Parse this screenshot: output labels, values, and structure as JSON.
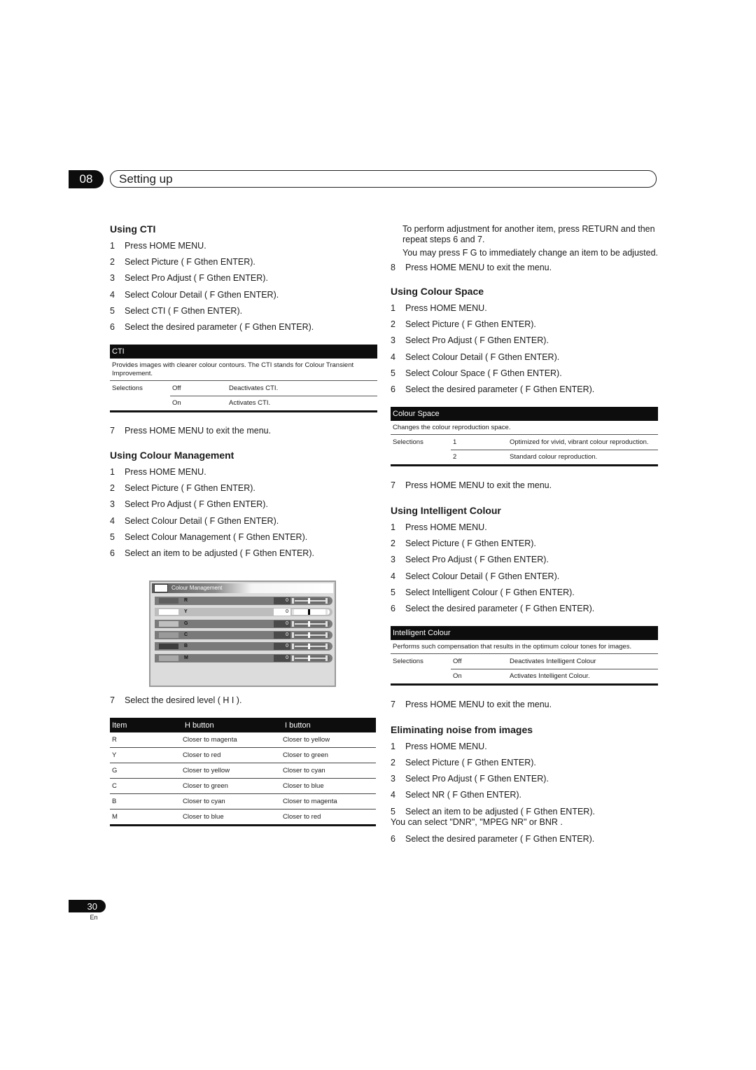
{
  "header": {
    "chapter_number": "08",
    "chapter_title": "Setting up"
  },
  "cti": {
    "title": "Using CTI",
    "steps": [
      {
        "n": "1",
        "text": "Press HOME MENU."
      },
      {
        "n": "2",
        "text": "Select  Picture  (   F   Gthen ENTER)."
      },
      {
        "n": "3",
        "text": "Select  Pro Adjust  (   F   Gthen ENTER)."
      },
      {
        "n": "4",
        "text": "Select  Colour Detail  (    F   Gthen ENTER)."
      },
      {
        "n": "5",
        "text": "Select  CTI  (  F   Gthen ENTER)."
      },
      {
        "n": "6",
        "text": "Select the desired parameter (    F   Gthen ENTER)."
      }
    ],
    "table": {
      "head": "CTI",
      "desc": "Provides images with clearer colour contours. The CTI stands for Colour Transient Improvement.",
      "selections_label": "Selections",
      "rows": [
        {
          "option": "Off",
          "meaning": "Deactivates CTI."
        },
        {
          "option": "On",
          "meaning": "Activates CTI."
        }
      ]
    },
    "step7": {
      "n": "7",
      "text": "Press HOME MENU to exit the menu."
    }
  },
  "colour_management": {
    "title": "Using Colour Management",
    "steps": [
      {
        "n": "1",
        "text": "Press HOME MENU."
      },
      {
        "n": "2",
        "text": "Select  Picture  (   F   Gthen ENTER)."
      },
      {
        "n": "3",
        "text": "Select  Pro Adjust  (   F   Gthen ENTER)."
      },
      {
        "n": "4",
        "text": "Select  Colour Detail  (    F   Gthen ENTER)."
      },
      {
        "n": "5",
        "text": "Select  Colour Management  (     F   Gthen ENTER)."
      },
      {
        "n": "6",
        "text": "Select an item to be adjusted (    F   Gthen ENTER)."
      }
    ],
    "osd": {
      "title": "Colour Management",
      "selected_item": "Y",
      "rows": [
        {
          "label": "R",
          "value": "0",
          "swatch": "#5e5e5e",
          "level": 0.5
        },
        {
          "label": "Y",
          "value": "0",
          "swatch": "#ffffff",
          "level": 0.5
        },
        {
          "label": "G",
          "value": "0",
          "swatch": "#bfbfbf",
          "level": 0.5
        },
        {
          "label": "C",
          "value": "0",
          "swatch": "#9a9a9a",
          "level": 0.5
        },
        {
          "label": "B",
          "value": "0",
          "swatch": "#3c3c3c",
          "level": 0.5
        },
        {
          "label": "M",
          "value": "0",
          "swatch": "#a8a8a8",
          "level": 0.5
        }
      ]
    },
    "step7": {
      "n": "7",
      "text": "Select the desired level (   H   I  )."
    },
    "item_table": {
      "headers": [
        "Item",
        " H  button",
        " I   button"
      ],
      "rows": [
        [
          "R",
          "Closer to magenta",
          "Closer to yellow"
        ],
        [
          "Y",
          "Closer to red",
          "Closer to green"
        ],
        [
          "G",
          "Closer to yellow",
          "Closer to cyan"
        ],
        [
          "C",
          "Closer to green",
          "Closer to blue"
        ],
        [
          "B",
          "Closer to cyan",
          "Closer to magenta"
        ],
        [
          "M",
          "Closer to blue",
          "Closer to red"
        ]
      ]
    },
    "notes": [
      "To perform adjustment for another item, press RETURN and then repeat steps 6 and 7.",
      "You may press  F    G to immediately change an item to be adjusted."
    ],
    "step8": {
      "n": "8",
      "text": "Press HOME MENU to exit the menu."
    }
  },
  "colour_space": {
    "title": "Using Colour Space",
    "steps": [
      {
        "n": "1",
        "text": "Press HOME MENU."
      },
      {
        "n": "2",
        "text": "Select  Picture  (   F   Gthen ENTER)."
      },
      {
        "n": "3",
        "text": "Select  Pro Adjust  (   F   Gthen ENTER)."
      },
      {
        "n": "4",
        "text": "Select  Colour Detail  (    F   Gthen ENTER)."
      },
      {
        "n": "5",
        "text": "Select  Colour Space  (   F   Gthen ENTER)."
      },
      {
        "n": "6",
        "text": "Select the desired parameter (    F   Gthen ENTER)."
      }
    ],
    "table": {
      "head": "Colour Space",
      "desc": "Changes the colour reproduction space.",
      "selections_label": "Selections",
      "rows": [
        {
          "option": "1",
          "meaning": "Optimized for vivid, vibrant colour reproduction."
        },
        {
          "option": "2",
          "meaning": "Standard colour reproduction."
        }
      ]
    },
    "step7": {
      "n": "7",
      "text": "Press HOME MENU to exit the menu."
    }
  },
  "intelligent_colour": {
    "title": "Using Intelligent Colour",
    "steps": [
      {
        "n": "1",
        "text": "Press HOME MENU."
      },
      {
        "n": "2",
        "text": "Select  Picture  (   F   Gthen ENTER)."
      },
      {
        "n": "3",
        "text": "Select  Pro Adjust  (   F   Gthen ENTER)."
      },
      {
        "n": "4",
        "text": "Select  Colour Detail  (    F   Gthen ENTER)."
      },
      {
        "n": "5",
        "text": "Select  Intelligent Colour  (     F   Gthen ENTER)."
      },
      {
        "n": "6",
        "text": "Select the desired parameter (    F   Gthen ENTER)."
      }
    ],
    "table": {
      "head": "Intelligent Colour",
      "desc": "Performs such compensation that results in the optimum colour tones for images.",
      "selections_label": "Selections",
      "rows": [
        {
          "option": "Off",
          "meaning": "Deactivates Intelligent Colour"
        },
        {
          "option": "On",
          "meaning": "Activates Intelligent Colour."
        }
      ]
    },
    "step7": {
      "n": "7",
      "text": "Press HOME MENU to exit the menu."
    }
  },
  "noise": {
    "title": "Eliminating noise from images",
    "steps": [
      {
        "n": "1",
        "text": "Press HOME MENU."
      },
      {
        "n": "2",
        "text": "Select  Picture  (   F   Gthen ENTER)."
      },
      {
        "n": "3",
        "text": "Select  Pro Adjust  (   F   Gthen ENTER)."
      },
      {
        "n": "4",
        "text": "Select  NR  (  F   Gthen ENTER)."
      },
      {
        "n": "5",
        "text": "Select an item to be adjusted (    F   Gthen ENTER)."
      }
    ],
    "step5_note": "You can select \"DNR\", \"MPEG NR\" or  BNR .",
    "step6": {
      "n": "6",
      "text": "Select the desired parameter (    F   Gthen ENTER)."
    }
  },
  "footer": {
    "page_number": "30",
    "language": "En"
  }
}
